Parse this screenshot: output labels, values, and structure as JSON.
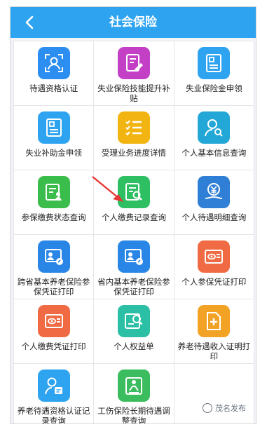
{
  "header": {
    "title": "社会保险",
    "back_icon": "back-chevron-icon"
  },
  "items": [
    {
      "label": "待遇资格认证",
      "icon": "face-frame-icon",
      "color": "#2b8ef0"
    },
    {
      "label": "失业保险技能提升补贴",
      "icon": "edit-doc-icon",
      "color": "#c33fc6"
    },
    {
      "label": "失业保险金申领",
      "icon": "id-card-icon",
      "color": "#2ea4f0"
    },
    {
      "label": "失业补助金申领",
      "icon": "id-card-icon",
      "color": "#2ea4f0"
    },
    {
      "label": "受理业务进度详情",
      "icon": "checklist-icon",
      "color": "#f2b411"
    },
    {
      "label": "个人基本信息查询",
      "icon": "person-search-icon",
      "color": "#23a7d6"
    },
    {
      "label": "参保缴费状态查询",
      "icon": "doc-person-icon",
      "color": "#3bbd4b"
    },
    {
      "label": "个人缴费记录查询",
      "icon": "doc-search-icon",
      "color": "#2fbf63"
    },
    {
      "label": "个人待遇明细查询",
      "icon": "yuan-hand-icon",
      "color": "#2f7fd6"
    },
    {
      "label": "跨省基本养老保险参保凭证打印",
      "icon": "card-edit-icon",
      "color": "#2a86e6"
    },
    {
      "label": "省内基本养老保险参保凭证打印",
      "icon": "card-edit-icon",
      "color": "#2a86e6"
    },
    {
      "label": "个人参保凭证打印",
      "icon": "card-eye-icon",
      "color": "#f06b43"
    },
    {
      "label": "个人缴费凭证打印",
      "icon": "card-eye-icon",
      "color": "#f06b43"
    },
    {
      "label": "个人权益单",
      "icon": "rights-doc-icon",
      "color": "#2bbfa5"
    },
    {
      "label": "养老待遇收入证明打印",
      "icon": "doc-add-icon",
      "color": "#f2a325"
    },
    {
      "label": "养老待遇资格认证记录查询",
      "icon": "person-doc-icon",
      "color": "#2ea4f0"
    },
    {
      "label": "工伤保险长期待遇调整查询",
      "icon": "injury-doc-icon",
      "color": "#3bbd5f"
    }
  ],
  "watermark": {
    "text": "茂名发布",
    "icon": "wechat-channel-icon"
  },
  "annotation": {
    "icon": "red-arrow-icon",
    "color": "#e53935"
  }
}
